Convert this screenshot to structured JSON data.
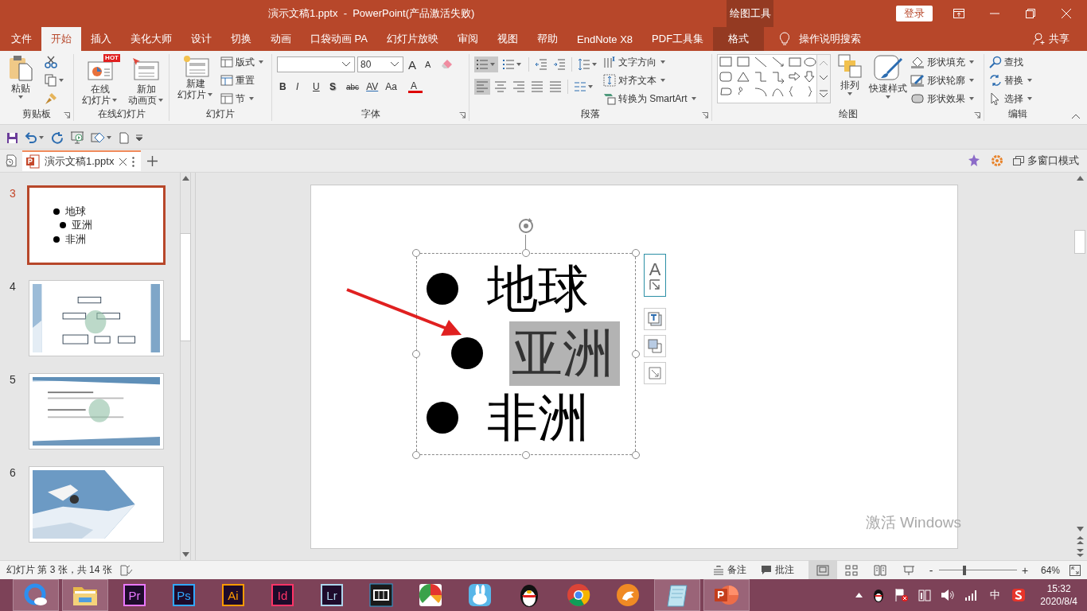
{
  "title_bar": {
    "document_title": "演示文稿1.pptx  -  PowerPoint(产品激活失败)",
    "context_title": "绘图工具",
    "login_button": "登录"
  },
  "tabs": [
    {
      "label": "文件",
      "selected": false,
      "kind": "normal"
    },
    {
      "label": "开始",
      "selected": true,
      "kind": "normal"
    },
    {
      "label": "插入",
      "selected": false,
      "kind": "normal"
    },
    {
      "label": "美化大师",
      "selected": false,
      "kind": "normal"
    },
    {
      "label": "设计",
      "selected": false,
      "kind": "normal"
    },
    {
      "label": "切换",
      "selected": false,
      "kind": "normal"
    },
    {
      "label": "动画",
      "selected": false,
      "kind": "normal"
    },
    {
      "label": "口袋动画 PA",
      "selected": false,
      "kind": "normal"
    },
    {
      "label": "幻灯片放映",
      "selected": false,
      "kind": "normal"
    },
    {
      "label": "审阅",
      "selected": false,
      "kind": "normal"
    },
    {
      "label": "视图",
      "selected": false,
      "kind": "normal"
    },
    {
      "label": "帮助",
      "selected": false,
      "kind": "normal"
    },
    {
      "label": "EndNote X8",
      "selected": false,
      "kind": "normal"
    },
    {
      "label": "PDF工具集",
      "selected": false,
      "kind": "normal"
    },
    {
      "label": "格式",
      "selected": false,
      "kind": "context"
    }
  ],
  "tell_me": "操作说明搜索",
  "share": "共享",
  "ribbon": {
    "groups": [
      {
        "kind": "clipboard",
        "label": "剪贴板",
        "large": [
          {
            "label": "粘贴"
          }
        ]
      },
      {
        "kind": "online",
        "label": "在线幻灯片",
        "large": [
          {
            "lines": [
              "在线",
              "幻灯片"
            ],
            "badge": "HOT"
          },
          {
            "lines": [
              "新加",
              "动画页"
            ]
          }
        ]
      },
      {
        "kind": "slides",
        "label": "幻灯片",
        "large": [
          {
            "lines": [
              "新建",
              "幻灯片"
            ]
          }
        ],
        "small": [
          {
            "label": "版式"
          },
          {
            "label": "重置"
          },
          {
            "label": "节"
          }
        ]
      },
      {
        "kind": "font",
        "label": "字体",
        "font_size": "80",
        "grow_font": "A",
        "shrink_font": "A",
        "format": [
          "B",
          "I",
          "U",
          "S",
          "abc",
          "AV",
          "Aa",
          "A"
        ]
      },
      {
        "kind": "paragraph",
        "label": "段落",
        "list_buttons": [
          {
            "selected": true
          },
          {
            "selected": false
          }
        ],
        "align_buttons": [
          {
            "selected": true
          },
          {
            "selected": false
          },
          {
            "selected": false
          },
          {
            "selected": false
          },
          {
            "selected": false
          }
        ],
        "small": [
          {
            "label": "文字方向"
          },
          {
            "label": "对齐文本"
          },
          {
            "label": "转换为 SmartArt"
          }
        ]
      },
      {
        "kind": "drawing",
        "label": "绘图",
        "large": [
          {
            "label": "排列"
          },
          {
            "label": "快速样式"
          }
        ],
        "small": [
          {
            "label": "形状填充"
          },
          {
            "label": "形状轮廓"
          },
          {
            "label": "形状效果"
          }
        ]
      },
      {
        "kind": "editing",
        "label": "编辑",
        "small": [
          {
            "label": "查找"
          },
          {
            "label": "替换"
          },
          {
            "label": "选择"
          }
        ]
      }
    ]
  },
  "document_tab": {
    "label": "演示文稿1.pptx",
    "multi_window": "多窗口模式"
  },
  "slides_panel": [
    {
      "number": "3",
      "selected": true,
      "kind": "text",
      "bullets": [
        {
          "text": "地球",
          "children": [
            {
              "text": "亚洲"
            }
          ]
        },
        {
          "text": "非洲"
        }
      ]
    },
    {
      "number": "4",
      "selected": false,
      "kind": "picture"
    },
    {
      "number": "5",
      "selected": false,
      "kind": "picture"
    },
    {
      "number": "6",
      "selected": false,
      "kind": "picture"
    }
  ],
  "slide": {
    "bullets": [
      {
        "text": "地球",
        "highlighted": false,
        "children": [
          {
            "text": "亚洲",
            "highlighted": true
          }
        ]
      },
      {
        "text": "非洲",
        "highlighted": false
      }
    ],
    "style_letter": "A"
  },
  "activation_notice": "激活 Windows",
  "status_bar": {
    "slide_info": "幻灯片 第 3 张，共 14 张",
    "notes": "备注",
    "comments": "批注",
    "views": [
      {
        "selected": true
      },
      {
        "selected": false
      },
      {
        "selected": false
      },
      {
        "selected": false
      }
    ],
    "zoom_out": "-",
    "zoom_in": "+",
    "zoom": {
      "level": 0.33
    },
    "zoom_text": "64%"
  },
  "taskbar": {
    "items": [
      {
        "kind": "browser",
        "active": true
      },
      {
        "kind": "folder",
        "active": true
      },
      {
        "kind": "tile",
        "label": "Pr",
        "color": "#ea77ff",
        "active": false
      },
      {
        "kind": "tile",
        "label": "Ps",
        "color": "#31a8ff",
        "active": false
      },
      {
        "kind": "tile",
        "label": "Ai",
        "color": "#ff9a00",
        "active": false
      },
      {
        "kind": "tile",
        "label": "Id",
        "color": "#ff3366",
        "active": false
      },
      {
        "kind": "tile",
        "label": "Lr",
        "color": "#add5ec",
        "active": false
      },
      {
        "kind": "film",
        "active": false
      },
      {
        "kind": "pie",
        "active": false
      },
      {
        "kind": "rabbit",
        "active": false
      },
      {
        "kind": "penguin",
        "active": false
      },
      {
        "kind": "chrome",
        "active": false
      },
      {
        "kind": "orange",
        "active": false
      },
      {
        "kind": "notepad",
        "active": true
      },
      {
        "kind": "powerpoint",
        "active": true
      }
    ],
    "ime": "中",
    "time": "15:32",
    "date": "2020/8/4"
  }
}
